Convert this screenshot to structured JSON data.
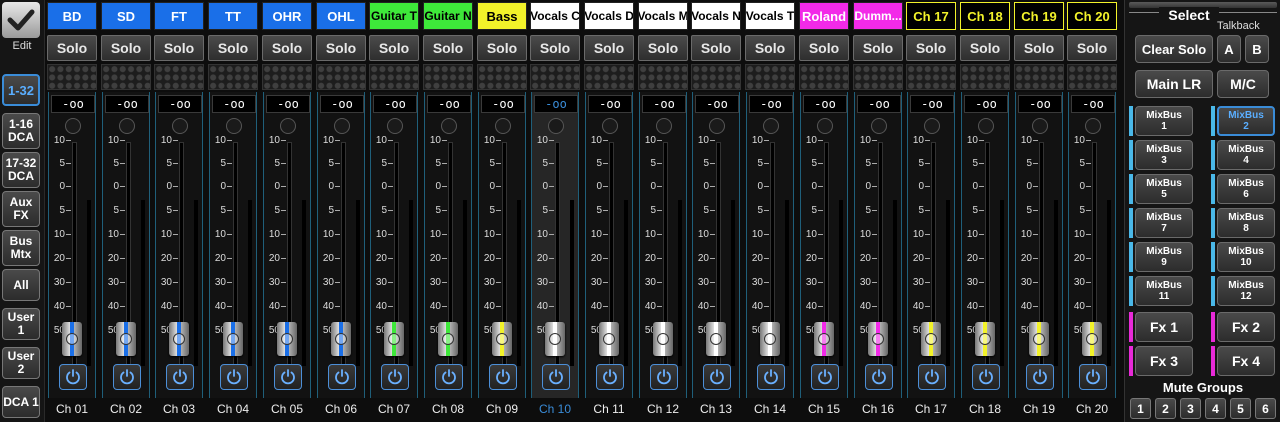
{
  "left_panel": {
    "edit_label": "Edit",
    "buttons": [
      {
        "label": "1-32",
        "active": true
      },
      {
        "label": "1-16\nDCA",
        "active": false
      },
      {
        "label": "17-32\nDCA",
        "active": false
      },
      {
        "label": "Aux\nFX",
        "active": false
      },
      {
        "label": "Bus\nMtx",
        "active": false
      },
      {
        "label": "All",
        "active": false
      },
      {
        "label": "User 1",
        "active": false
      },
      {
        "label": "User 2",
        "active": false
      },
      {
        "label": "DCA 1",
        "active": false
      }
    ]
  },
  "solo_label": "Solo",
  "scale_ticks": [
    "10",
    "5",
    "0",
    "5",
    "10",
    "20",
    "30",
    "40",
    "50"
  ],
  "channels": [
    {
      "name": "BD",
      "color": "#1a6fe8",
      "text": "#ffffff",
      "gain": "-oo",
      "label": "Ch 01",
      "stripe": "#1a6fe8",
      "selected": false
    },
    {
      "name": "SD",
      "color": "#1a6fe8",
      "text": "#ffffff",
      "gain": "-oo",
      "label": "Ch 02",
      "stripe": "#1a6fe8",
      "selected": false
    },
    {
      "name": "FT",
      "color": "#1a6fe8",
      "text": "#ffffff",
      "gain": "-oo",
      "label": "Ch 03",
      "stripe": "#1a6fe8",
      "selected": false
    },
    {
      "name": "TT",
      "color": "#1a6fe8",
      "text": "#ffffff",
      "gain": "-oo",
      "label": "Ch 04",
      "stripe": "#1a6fe8",
      "selected": false
    },
    {
      "name": "OHR",
      "color": "#1a6fe8",
      "text": "#ffffff",
      "gain": "-oo",
      "label": "Ch 05",
      "stripe": "#1a6fe8",
      "selected": false
    },
    {
      "name": "OHL",
      "color": "#1a6fe8",
      "text": "#ffffff",
      "gain": "-oo",
      "label": "Ch 06",
      "stripe": "#1a6fe8",
      "selected": false
    },
    {
      "name": "Guitar T",
      "color": "#3ee83a",
      "text": "#000000",
      "gain": "-oo",
      "label": "Ch 07",
      "stripe": "#3ee83a",
      "selected": false
    },
    {
      "name": "Guitar N",
      "color": "#3ee83a",
      "text": "#000000",
      "gain": "-oo",
      "label": "Ch 08",
      "stripe": "#3ee83a",
      "selected": false
    },
    {
      "name": "Bass",
      "color": "#f2f22a",
      "text": "#000000",
      "gain": "-oo",
      "label": "Ch 09",
      "stripe": "#f2f22a",
      "selected": false
    },
    {
      "name": "Vocals C",
      "color": "#ffffff",
      "text": "#000000",
      "gain": "-oo",
      "label": "Ch 10",
      "stripe": "#ffffff",
      "selected": true
    },
    {
      "name": "Vocals D",
      "color": "#ffffff",
      "text": "#000000",
      "gain": "-oo",
      "label": "Ch 11",
      "stripe": "#ffffff",
      "selected": false
    },
    {
      "name": "Vocals M",
      "color": "#ffffff",
      "text": "#000000",
      "gain": "-oo",
      "label": "Ch 12",
      "stripe": "#ffffff",
      "selected": false
    },
    {
      "name": "Vocals N",
      "color": "#ffffff",
      "text": "#000000",
      "gain": "-oo",
      "label": "Ch 13",
      "stripe": "#ffffff",
      "selected": false
    },
    {
      "name": "Vocals T",
      "color": "#ffffff",
      "text": "#000000",
      "gain": "-oo",
      "label": "Ch 14",
      "stripe": "#ffffff",
      "selected": false
    },
    {
      "name": "Roland",
      "color": "#f22ae8",
      "text": "#ffffff",
      "gain": "-oo",
      "label": "Ch 15",
      "stripe": "#f22ae8",
      "selected": false
    },
    {
      "name": "Dumm...",
      "color": "#f22ae8",
      "text": "#ffffff",
      "gain": "-oo",
      "label": "Ch 16",
      "stripe": "#f22ae8",
      "selected": false
    },
    {
      "name": "Ch 17",
      "color": "#000000",
      "text": "#f2f22a",
      "gain": "-oo",
      "label": "Ch 17",
      "stripe": "#f2f22a",
      "selected": false
    },
    {
      "name": "Ch 18",
      "color": "#000000",
      "text": "#f2f22a",
      "gain": "-oo",
      "label": "Ch 18",
      "stripe": "#f2f22a",
      "selected": false
    },
    {
      "name": "Ch 19",
      "color": "#000000",
      "text": "#f2f22a",
      "gain": "-oo",
      "label": "Ch 19",
      "stripe": "#f2f22a",
      "selected": false
    },
    {
      "name": "Ch 20",
      "color": "#000000",
      "text": "#f2f22a",
      "gain": "-oo",
      "label": "Ch 20",
      "stripe": "#f2f22a",
      "selected": false
    }
  ],
  "right_panel": {
    "select_label": "Select",
    "talkback_label": "Talkback",
    "clear_solo": "Clear Solo",
    "talkback_a": "A",
    "talkback_b": "B",
    "main_lr": "Main LR",
    "mc": "M/C",
    "mixbuses": [
      {
        "label": "MixBus\n1",
        "active": false,
        "bar": "#4ab8e8"
      },
      {
        "label": "MixBus\n2",
        "active": true,
        "bar": "#4ab8e8"
      },
      {
        "label": "MixBus\n3",
        "active": false,
        "bar": "#4ab8e8"
      },
      {
        "label": "MixBus\n4",
        "active": false,
        "bar": "#4ab8e8"
      },
      {
        "label": "MixBus\n5",
        "active": false,
        "bar": "#4ab8e8"
      },
      {
        "label": "MixBus\n6",
        "active": false,
        "bar": "#4ab8e8"
      },
      {
        "label": "MixBus\n7",
        "active": false,
        "bar": "#4ab8e8"
      },
      {
        "label": "MixBus\n8",
        "active": false,
        "bar": "#4ab8e8"
      },
      {
        "label": "MixBus\n9",
        "active": false,
        "bar": "#4ab8e8"
      },
      {
        "label": "MixBus\n10",
        "active": false,
        "bar": "#4ab8e8"
      },
      {
        "label": "MixBus\n11",
        "active": false,
        "bar": "#4ab8e8"
      },
      {
        "label": "MixBus\n12",
        "active": false,
        "bar": "#4ab8e8"
      }
    ],
    "fx": [
      {
        "label": "Fx 1",
        "bar": "#e82ad8"
      },
      {
        "label": "Fx 2",
        "bar": "#e82ad8"
      },
      {
        "label": "Fx 3",
        "bar": "#e82ad8"
      },
      {
        "label": "Fx 4",
        "bar": "#e82ad8"
      }
    ],
    "mute_groups_label": "Mute Groups",
    "mute_groups": [
      "1",
      "2",
      "3",
      "4",
      "5",
      "6"
    ]
  }
}
